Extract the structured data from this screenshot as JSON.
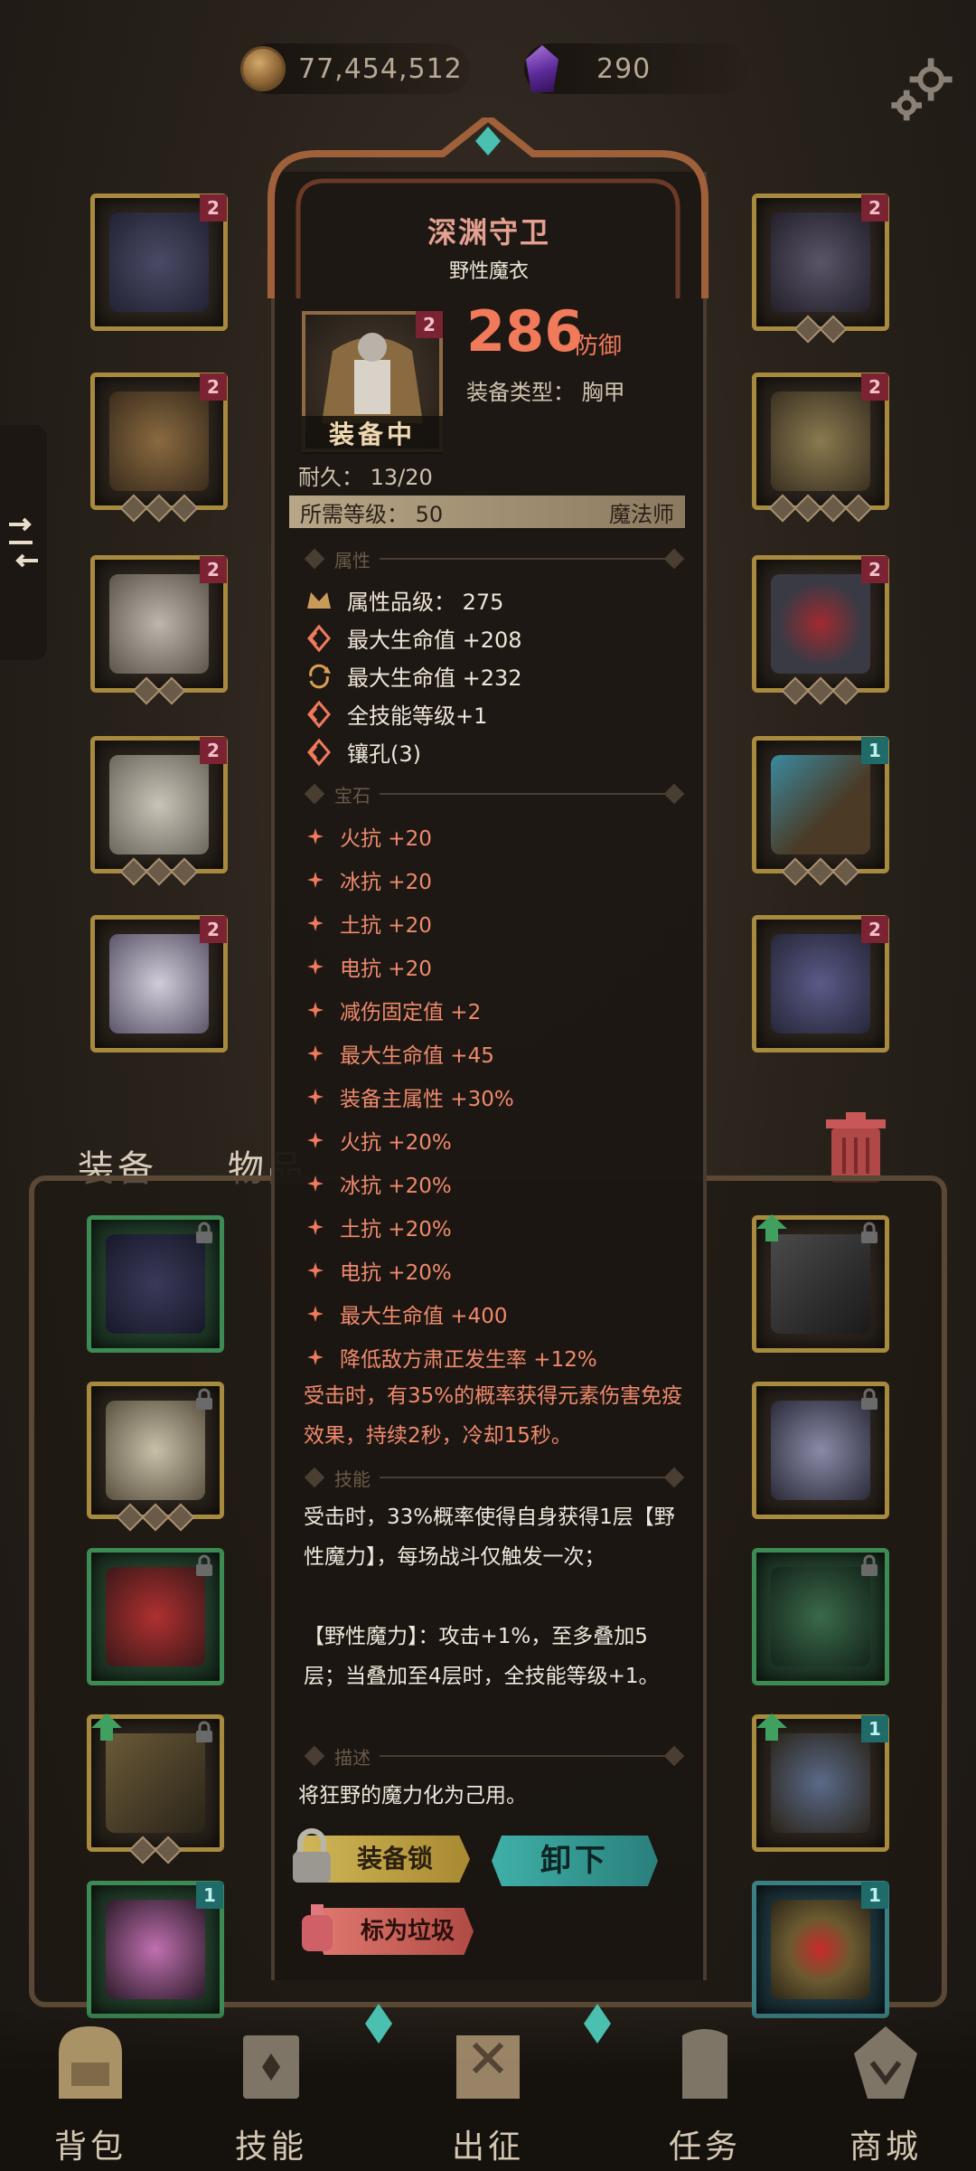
{
  "currency": {
    "gold": "77,454,512",
    "gems": "290"
  },
  "tabs": {
    "equipment": "装备",
    "items": "物品"
  },
  "item": {
    "name": "深渊守卫",
    "subtitle": "野性魔衣",
    "equipped_label": "装备中",
    "defense_value": "286",
    "defense_label": "防御",
    "equip_type": "装备类型：  胸甲",
    "durability": "耐久：  13/20",
    "required_level": "所需等级：  50",
    "required_class": "魔法师",
    "section_attributes": "属性",
    "attributes": [
      "属性品级：  275",
      "最大生命值 +208",
      "最大生命值 +232",
      "全技能等级+1",
      "镶孔(3)"
    ],
    "section_gems": "宝石",
    "gems": [
      "火抗 +20",
      "冰抗 +20",
      "土抗 +20",
      "电抗 +20",
      "减伤固定值 +2",
      "最大生命值 +45",
      "装备主属性 +30%",
      "火抗 +20%",
      "冰抗 +20%",
      "土抗 +20%",
      "电抗 +20%",
      "最大生命值 +400",
      "降低敌方肃正发生率 +12%"
    ],
    "gem_effect": "受击时，有35%的概率获得元素伤害免疫效果，持续2秒，冷却15秒。",
    "section_skill": "技能",
    "skill_text_1": "受击时，33%概率使得自身获得1层【野性魔力】，每场战斗仅触发一次；",
    "skill_text_2": "【野性魔力】：攻击+1%，至多叠加5层；当叠加至4层时，全技能等级+1。",
    "section_desc": "描述",
    "description": "将狂野的魔力化为己用。"
  },
  "buttons": {
    "lock": "装备锁",
    "unequip": "卸下",
    "mark_trash": "标为垃圾"
  },
  "nav": [
    {
      "label": "背包"
    },
    {
      "label": "技能"
    },
    {
      "label": "出征"
    },
    {
      "label": "任务"
    },
    {
      "label": "商城"
    }
  ],
  "slot_badges": {
    "level2": "2",
    "level1": "1"
  },
  "colors": {
    "accent_red": "#f07a5a",
    "accent_teal": "#3fb0a8",
    "accent_gold": "#d2b85a"
  }
}
